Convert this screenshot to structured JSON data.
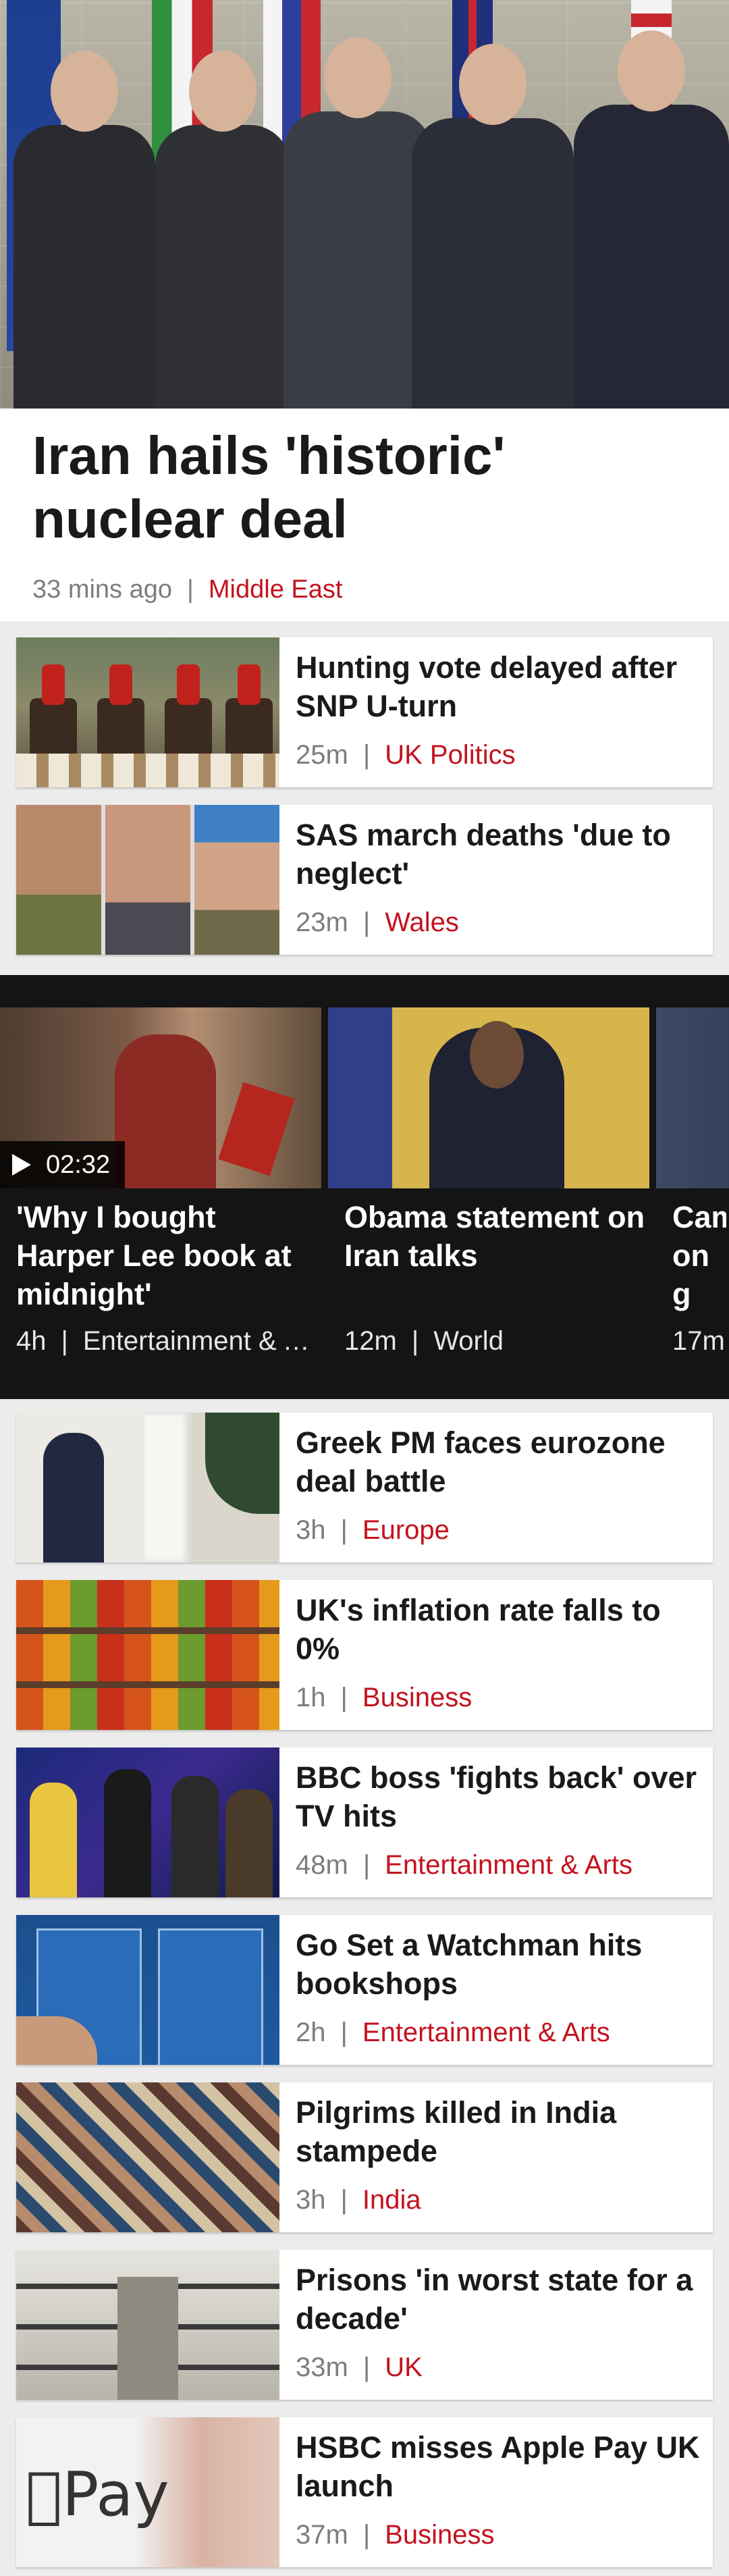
{
  "hero": {
    "title": "Iran hails 'historic' nuclear deal",
    "time": "33 mins ago",
    "separator": "|",
    "section": "Middle East"
  },
  "stories_top": [
    {
      "title": "Hunting vote delayed after SNP U-turn",
      "time": "25m",
      "section": "UK Politics"
    },
    {
      "title": "SAS march deaths 'due to neglect'",
      "time": "23m",
      "section": "Wales"
    }
  ],
  "videos": [
    {
      "title": "'Why I bought Harper Lee book at midnight'",
      "time": "4h",
      "section": "Entertainment & Arts",
      "duration": "02:32"
    },
    {
      "title": "Obama statement on Iran talks",
      "time": "12m",
      "section": "World"
    },
    {
      "title": "Cameron on g",
      "time": "17m",
      "section": ""
    }
  ],
  "stories_bottom": [
    {
      "title": "Greek PM faces eurozone deal battle",
      "time": "3h",
      "section": "Europe"
    },
    {
      "title": "UK's inflation rate falls to 0%",
      "time": "1h",
      "section": "Business"
    },
    {
      "title": "BBC boss 'fights back' over TV hits",
      "time": "48m",
      "section": "Entertainment & Arts"
    },
    {
      "title": "Go Set a Watchman hits bookshops",
      "time": "2h",
      "section": "Entertainment & Arts"
    },
    {
      "title": "Pilgrims killed in India stampede",
      "time": "3h",
      "section": "India"
    },
    {
      "title": "Prisons 'in worst state for a decade'",
      "time": "33m",
      "section": "UK"
    },
    {
      "title": "HSBC misses Apple Pay UK launch",
      "time": "37m",
      "section": "Business"
    }
  ],
  "thumbs": {
    "pay_logo": "Pay"
  },
  "colors": {
    "accent": "#c4121e",
    "meta_grey": "#7d7d7d",
    "background": "#ececec",
    "video_bg": "#141414"
  }
}
